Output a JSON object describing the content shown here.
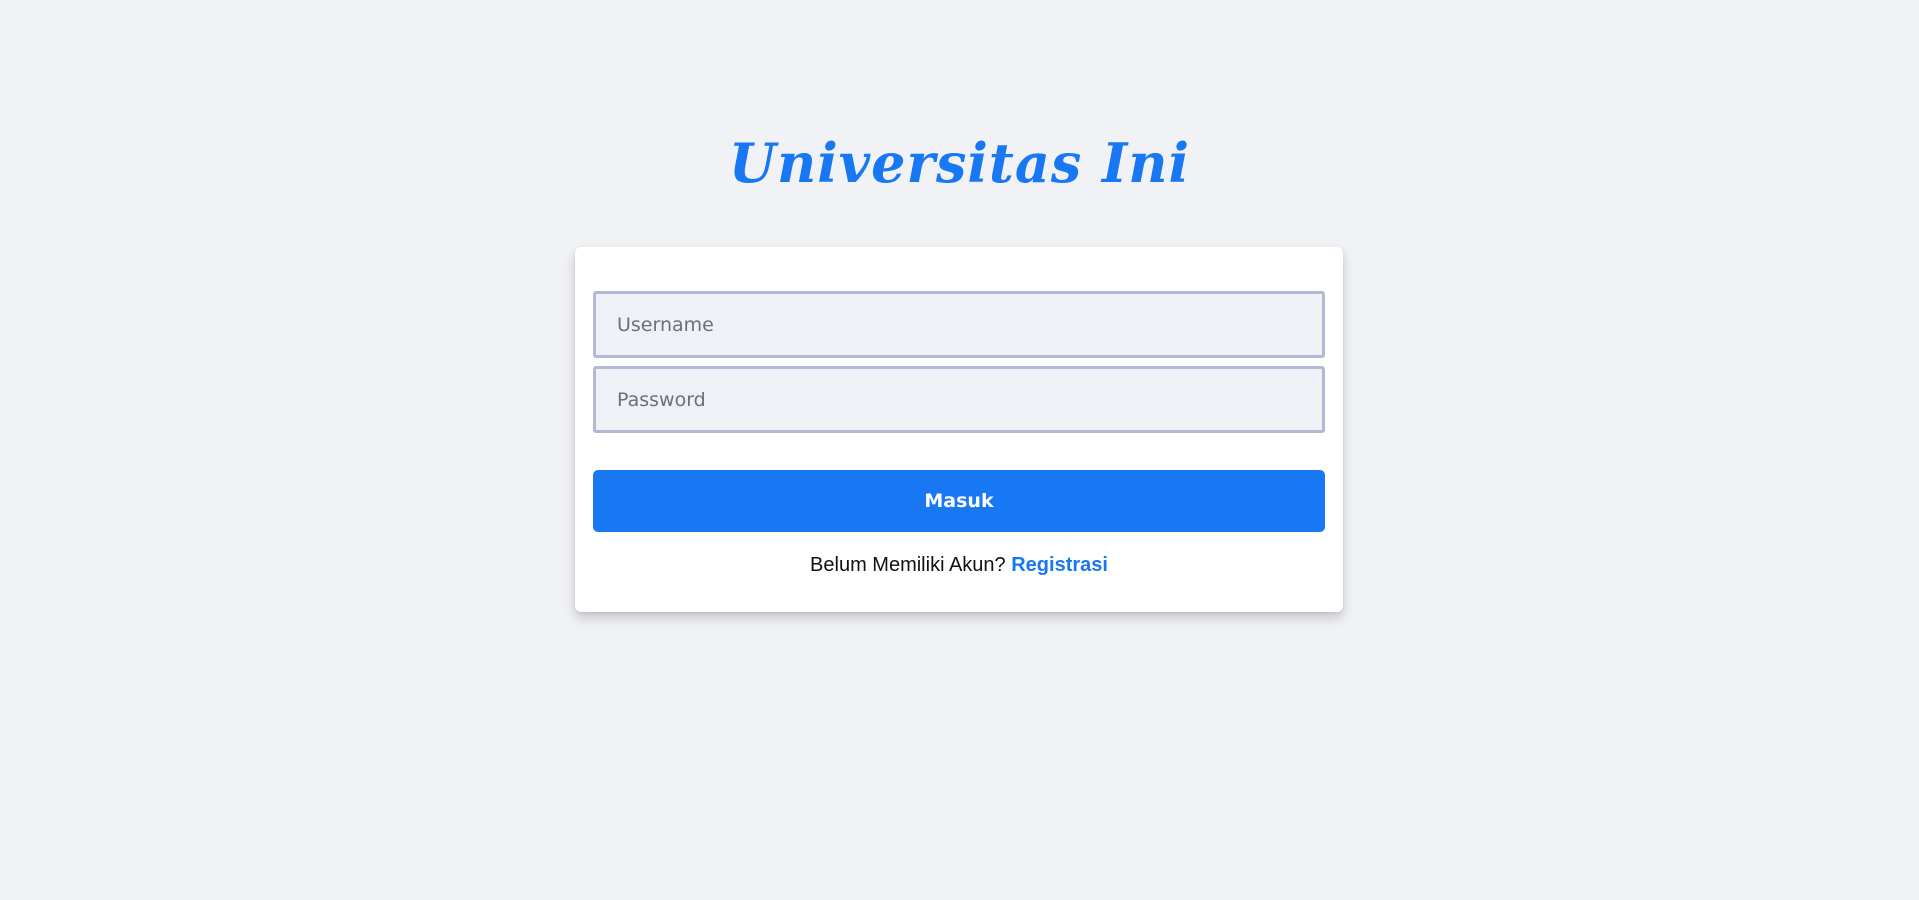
{
  "brand": {
    "title": "Universitas Ini"
  },
  "login_form": {
    "username_placeholder": "Username",
    "password_placeholder": "Password",
    "submit_label": "Masuk",
    "register_prompt": "Belum Memiliki Akun?",
    "register_link": "Registrasi"
  },
  "colors": {
    "accent": "#1877f2",
    "background": "#f0f2f6",
    "input_border": "#b3b9d4"
  }
}
